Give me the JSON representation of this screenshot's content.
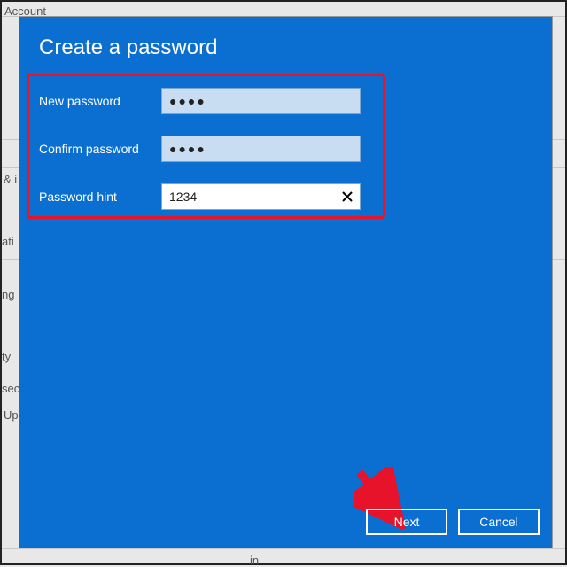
{
  "background": {
    "account": "Account",
    "amp_i": "& i",
    "ati": "ati",
    "ng": "ng",
    "ty": "ty",
    "sec": "sec",
    "up": "Up",
    "in": "in"
  },
  "dialog": {
    "title": "Create a password",
    "labels": {
      "new_password": "New password",
      "confirm_password": "Confirm password",
      "password_hint": "Password hint"
    },
    "values": {
      "new_password": "●●●●",
      "confirm_password": "●●●●",
      "password_hint": "1234"
    },
    "buttons": {
      "next": "Next",
      "cancel": "Cancel"
    }
  }
}
